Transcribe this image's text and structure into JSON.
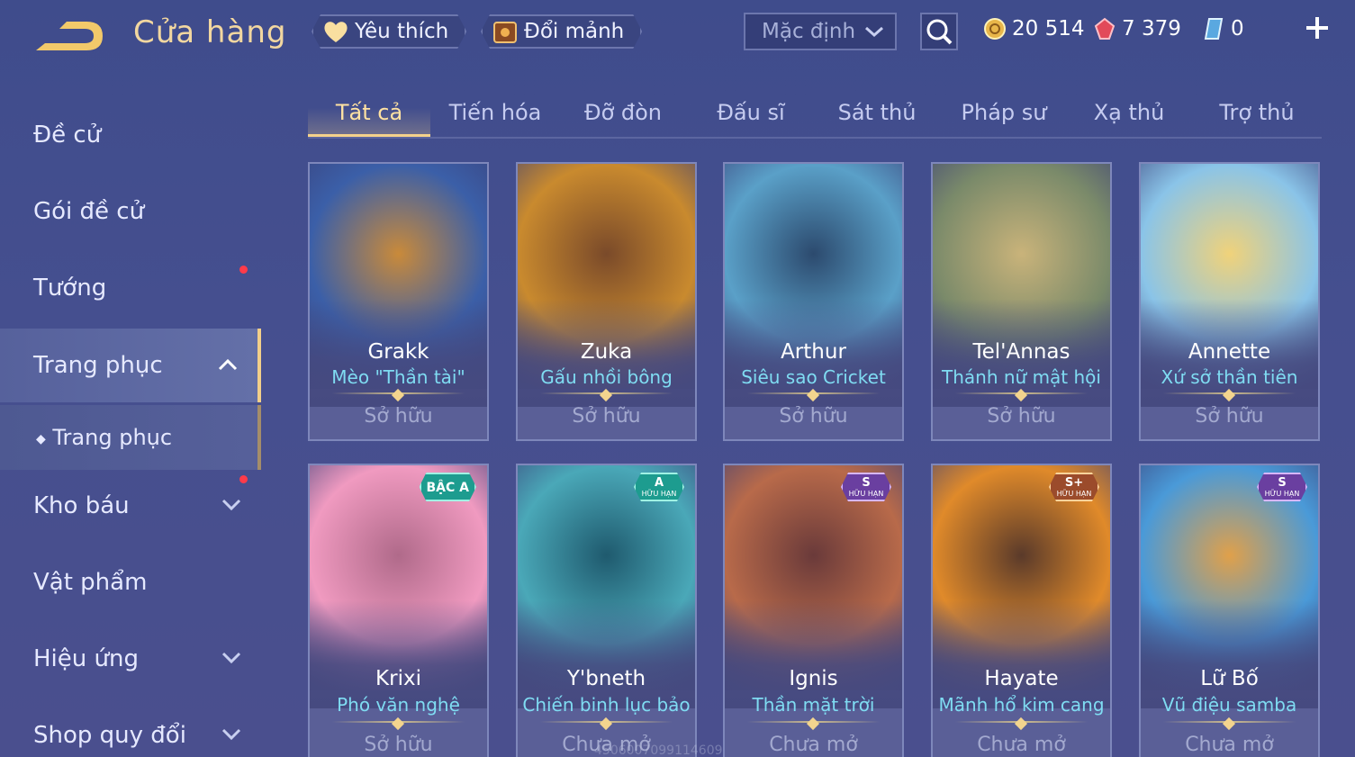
{
  "header": {
    "title": "Cửa hàng",
    "favorites_label": "Yêu thích",
    "exchange_label": "Đổi mảnh",
    "sort_value": "Mặc định",
    "currencies": [
      {
        "name": "gold-coin-icon",
        "value": "20 514"
      },
      {
        "name": "voucher-gem-icon",
        "value": "7 379"
      },
      {
        "name": "crystal-icon",
        "value": "0"
      }
    ]
  },
  "sidebar": {
    "items": [
      {
        "label": "Đề cử"
      },
      {
        "label": "Gói đề cử"
      },
      {
        "label": "Tướng"
      },
      {
        "label": "Trang phục"
      },
      {
        "label": "Trang phục"
      },
      {
        "label": "Kho báu"
      },
      {
        "label": "Vật phẩm"
      },
      {
        "label": "Hiệu ứng"
      },
      {
        "label": "Shop quy đổi"
      }
    ]
  },
  "tabs": [
    "Tất cả",
    "Tiến hóa",
    "Đỡ đòn",
    "Đấu sĩ",
    "Sát thủ",
    "Pháp sư",
    "Xạ thủ",
    "Trợ thủ"
  ],
  "cards": [
    {
      "hero": "Grakk",
      "skin": "Mèo \"Thần tài\"",
      "status": "Sở hữu",
      "badge": "",
      "colors": [
        "#3b5fa8",
        "#c98a3a"
      ]
    },
    {
      "hero": "Zuka",
      "skin": "Gấu nhồi bông",
      "status": "Sở hữu",
      "badge": "",
      "colors": [
        "#c98a2e",
        "#7a4a2a"
      ]
    },
    {
      "hero": "Arthur",
      "skin": "Siêu sao Cricket",
      "status": "Sở hữu",
      "badge": "",
      "colors": [
        "#5aa0c8",
        "#2c4a6e"
      ]
    },
    {
      "hero": "Tel'Annas",
      "skin": "Thánh nữ mật hội",
      "status": "Sở hữu",
      "badge": "",
      "colors": [
        "#7a8a6a",
        "#c9b37a"
      ]
    },
    {
      "hero": "Annette",
      "skin": "Xứ sở thần tiên",
      "status": "Sở hữu",
      "badge": "",
      "colors": [
        "#8ac4e8",
        "#f0d27a"
      ]
    },
    {
      "hero": "Krixi",
      "skin": "Phó văn nghệ",
      "status": "Sở hữu",
      "badge": "BẬC A",
      "badge_type": "a",
      "badge_sub": "",
      "colors": [
        "#f09ac0",
        "#b06a8a"
      ]
    },
    {
      "hero": "Y'bneth",
      "skin": "Chiến binh lục bảo",
      "status": "Chưa mở",
      "badge": "A",
      "badge_type": "a",
      "badge_sub": "HỮU HẠN",
      "colors": [
        "#4aa8b8",
        "#1f5a6e"
      ]
    },
    {
      "hero": "Ignis",
      "skin": "Thần mặt trời",
      "status": "Chưa mở",
      "badge": "S",
      "badge_type": "s",
      "badge_sub": "HỮU HẠN",
      "colors": [
        "#b86a4a",
        "#6a3a3a"
      ]
    },
    {
      "hero": "Hayate",
      "skin": "Mãnh hổ kim cang",
      "status": "Chưa mở",
      "badge": "S+",
      "badge_type": "sp",
      "badge_sub": "HỮU HẠN",
      "colors": [
        "#e08a2a",
        "#5a3a2a"
      ]
    },
    {
      "hero": "Lữ Bố",
      "skin": "Vũ điệu samba",
      "status": "Chưa mở",
      "badge": "S",
      "badge_type": "s",
      "badge_sub": "HỮU HẠN",
      "colors": [
        "#4a9ad8",
        "#e0a04a"
      ]
    }
  ],
  "watermark": "4506007099114609"
}
